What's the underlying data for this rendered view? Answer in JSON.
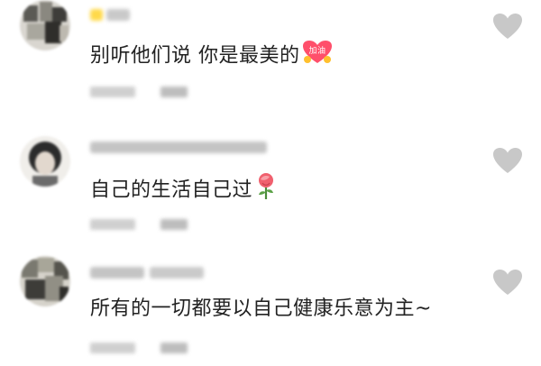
{
  "comments": [
    {
      "text": "别听他们说 你是最美的",
      "emoji": "jiayou-heart-icon",
      "emoji_text": "加油"
    },
    {
      "text": "自己的生活自己过",
      "emoji": "rose-icon"
    },
    {
      "text": "所有的一切都要以自己健康乐意为主~",
      "emoji": ""
    }
  ],
  "colors": {
    "text": "#222222",
    "heart": "#c8c8c8",
    "blur": "#cfcfcf"
  }
}
